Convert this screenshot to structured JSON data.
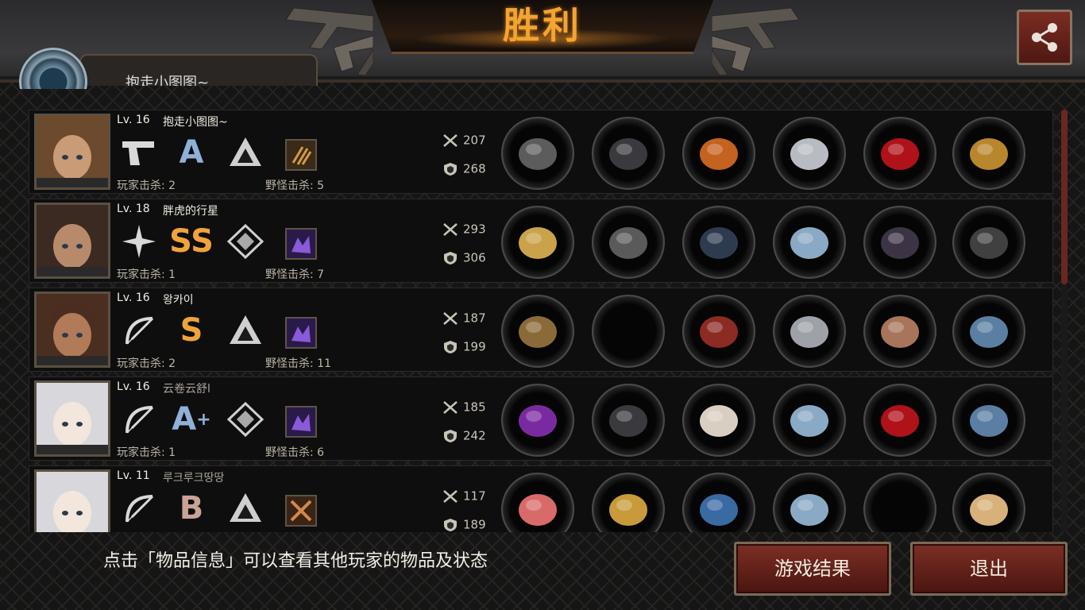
{
  "header": {
    "title": "胜利",
    "share_icon": "share-icon",
    "player_tab_label": "抱走小图图~"
  },
  "players": [
    {
      "level": "Lv. 16",
      "name": "抱走小图图~",
      "name_dim": false,
      "weapon_icon": "pistol-icon",
      "grade": "A",
      "grade_sup": "",
      "rank_icon": "triangle-rank-icon",
      "monster_icon": "bullet-pack-icon",
      "player_kills": "玩家击杀: 2",
      "monster_kills": "野怪击杀: 5",
      "attack": "207",
      "defense": "268",
      "items": [
        "sniper-rifle-icon",
        "tactical-helmet-icon",
        "flame-armor-icon",
        "silver-gauntlet-icon",
        "red-heels-icon",
        "gold-earrings-icon"
      ]
    },
    {
      "level": "Lv. 18",
      "name": "胖虎的行星",
      "name_dim": false,
      "weapon_icon": "shuriken-icon",
      "grade": "SS",
      "grade_sup": "",
      "rank_icon": "diamond-rank-icon",
      "monster_icon": "purple-monster-icon",
      "player_kills": "玩家击杀: 1",
      "monster_kills": "野怪击杀: 7",
      "attack": "293",
      "defense": "306",
      "items": [
        "chakram-icon",
        "knight-helmet-icon",
        "steel-armor-icon",
        "wrist-watch-icon",
        "dark-boots-icon",
        "black-flag-icon"
      ]
    },
    {
      "level": "Lv. 16",
      "name": "왕카이",
      "name_dim": false,
      "weapon_icon": "bow-icon",
      "grade": "S",
      "grade_sup": "",
      "rank_icon": "triangle-rank-icon",
      "monster_icon": "purple-monster-icon",
      "player_kills": "玩家击杀: 2",
      "monster_kills": "野怪击杀: 11",
      "attack": "187",
      "defense": "199",
      "items": [
        "long-bow-icon",
        "empty-slot",
        "red-cape-armor-icon",
        "silver-disc-icon",
        "bracer-icon",
        "quiver-icon"
      ]
    },
    {
      "level": "Lv. 16",
      "name": "云卷云舒l",
      "name_dim": true,
      "weapon_icon": "bow-icon",
      "grade": "A",
      "grade_sup": "+",
      "rank_icon": "diamond-rank-icon",
      "monster_icon": "purple-monster-icon",
      "player_kills": "玩家击杀: 1",
      "monster_kills": "野怪击杀: 6",
      "attack": "185",
      "defense": "242",
      "items": [
        "purple-bow-icon",
        "tactical-helmet-icon",
        "white-armor-icon",
        "wrist-watch-icon",
        "red-heels-icon",
        "quiver-icon"
      ]
    },
    {
      "level": "Lv. 11",
      "name": "루크루크땅땅",
      "name_dim": true,
      "weapon_icon": "bow-icon",
      "grade": "B",
      "grade_sup": "",
      "rank_icon": "triangle-rank-icon",
      "monster_icon": "crossed-tools-icon",
      "player_kills": "",
      "monster_kills": "",
      "attack": "117",
      "defense": "189",
      "items": [
        "angel-bow-icon",
        "gold-helmet-icon",
        "blue-robe-icon",
        "wrist-watch-icon",
        "empty-slot",
        "portrait-fan-icon"
      ]
    }
  ],
  "footer": {
    "hint": "点击「物品信息」可以查看其他玩家的物品及状态",
    "result_button": "游戏结果",
    "exit_button": "退出"
  },
  "colors": {
    "accent_gold": "#f2a531",
    "button_red": "#7c2f24",
    "grade_blue": "#8fb1d8"
  }
}
